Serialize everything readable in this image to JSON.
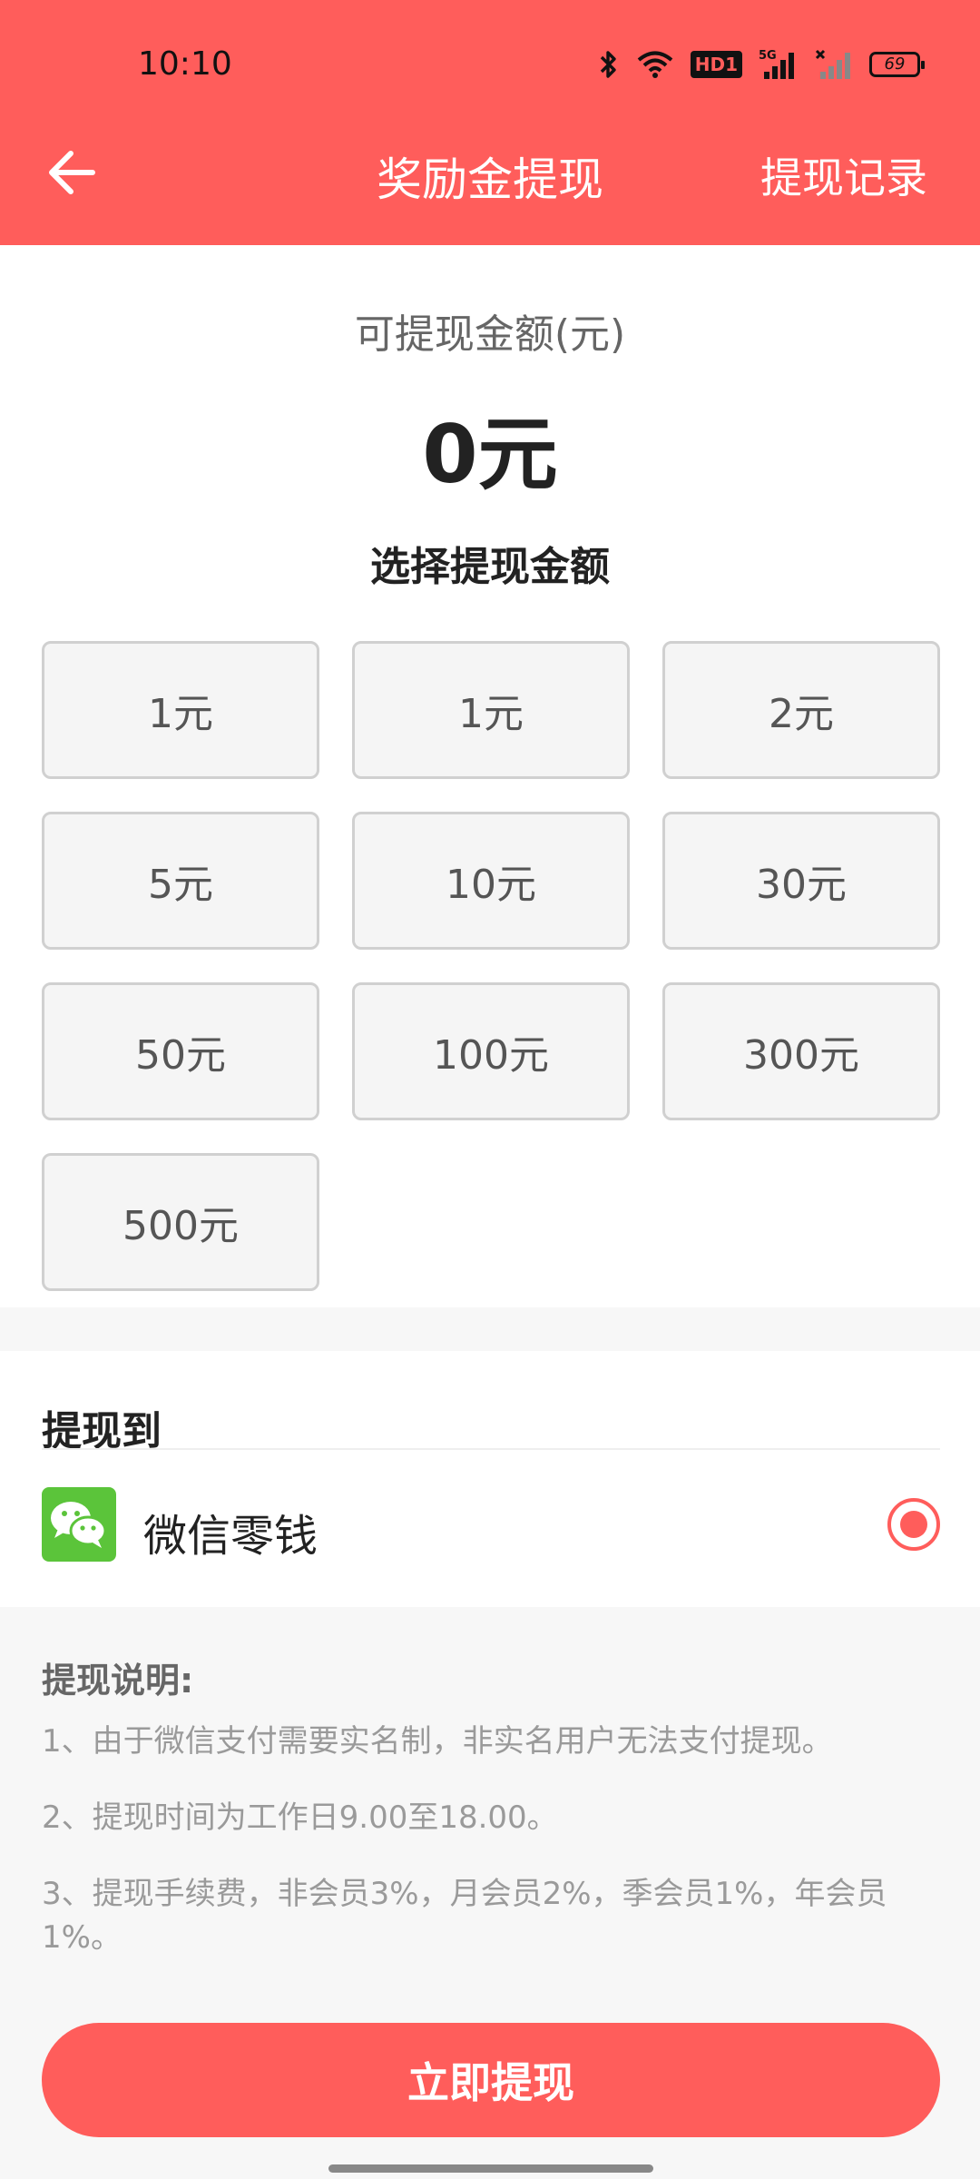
{
  "status_bar": {
    "time": "10:10",
    "hd_label": "HD1",
    "network_label": "5G",
    "battery": "69",
    "icons": [
      "bluetooth-icon",
      "wifi-icon",
      "hd-icon",
      "signal-5g-icon",
      "signal-empty-icon",
      "battery-icon"
    ]
  },
  "header": {
    "title": "奖励金提现",
    "action_label": "提现记录",
    "back_icon": "back-arrow-icon"
  },
  "balance": {
    "label": "可提现金额(元)",
    "value": "0元"
  },
  "amount_picker": {
    "title": "选择提现金额",
    "options": [
      "1元",
      "1元",
      "2元",
      "5元",
      "10元",
      "30元",
      "50元",
      "100元",
      "300元",
      "500元"
    ]
  },
  "destination": {
    "title": "提现到",
    "method_label": "微信零钱",
    "method_icon": "wechat-icon",
    "selected": true
  },
  "notes": {
    "title": "提现说明:",
    "items": [
      "1、由于微信支付需要实名制，非实名用户无法支付提现。",
      "2、提现时间为工作日9.00至18.00。",
      "3、提现手续费，非会员3%，月会员2%，季会员1%，年会员1%。"
    ]
  },
  "submit_label": "立即提现",
  "colors": {
    "accent": "#ff5d5b",
    "wechat_green": "#5bc43a"
  }
}
